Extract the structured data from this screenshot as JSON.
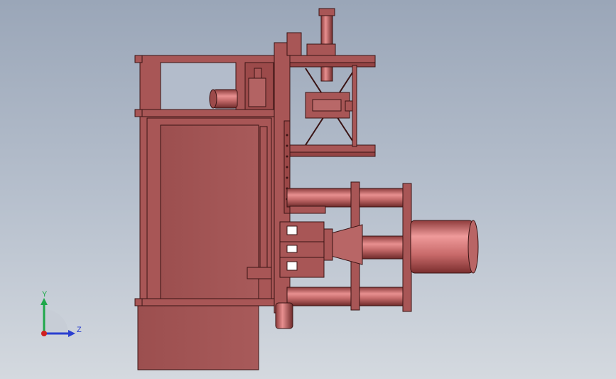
{
  "viewport": {
    "background_top": "#9aa6b8",
    "background_bottom": "#d4d9df",
    "part_color": "#a85656",
    "edge_color": "#3a1414"
  },
  "triad": {
    "y_label": "Y",
    "z_label": "Z",
    "y_color": "#1fa84a",
    "z_color": "#2a3fd0",
    "x_color": "#d02020"
  }
}
